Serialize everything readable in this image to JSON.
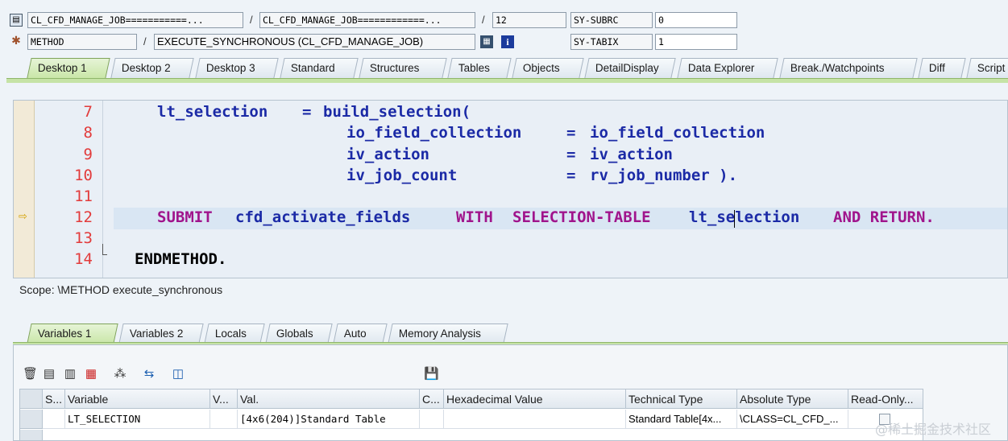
{
  "header": {
    "row1": {
      "field1": "CL_CFD_MANAGE_JOB===========...",
      "field2": "CL_CFD_MANAGE_JOB============...",
      "field3": "12",
      "sysvar_name": "SY-SUBRC",
      "sysvar_value": "0"
    },
    "row2": {
      "field1": "METHOD",
      "field2": "EXECUTE_SYNCHRONOUS (CL_CFD_MANAGE_JOB)",
      "sysvar_name": "SY-TABIX",
      "sysvar_value": "1"
    },
    "slash": "/"
  },
  "tabs": [
    "Desktop 1",
    "Desktop 2",
    "Desktop 3",
    "Standard",
    "Structures",
    "Tables",
    "Objects",
    "DetailDisplay",
    "Data Explorer",
    "Break./Watchpoints",
    "Diff",
    "Script"
  ],
  "editor": {
    "line_numbers": [
      "7",
      "8",
      "9",
      "10",
      "11",
      "12",
      "13",
      "14"
    ],
    "current_line_marker": "⇨",
    "lines": {
      "l7_a": "lt_selection",
      "l7_b": "=",
      "l7_c": "build_selection(",
      "l8_a": "io_field_collection",
      "l8_b": "=",
      "l8_c": "io_field_collection",
      "l9_a": "iv_action",
      "l9_b": "=",
      "l9_c": "iv_action",
      "l10_a": "iv_job_count",
      "l10_b": "=",
      "l10_c": "rv_job_number ).",
      "l12_a": "SUBMIT",
      "l12_b": "cfd_activate_fields",
      "l12_c": "WITH",
      "l12_d": "SELECTION-TABLE",
      "l12_e": "lt_selection",
      "l12_f": "AND RETURN.",
      "l14_a": "ENDMETHOD."
    }
  },
  "scope_text": "Scope: \\METHOD execute_synchronous",
  "var_tabs": [
    "Variables 1",
    "Variables 2",
    "Locals",
    "Globals",
    "Auto",
    "Memory Analysis"
  ],
  "grid": {
    "headers": [
      "S...",
      "Variable",
      "V...",
      "Val.",
      "C...",
      "Hexadecimal Value",
      "Technical Type",
      "Absolute Type",
      "Read-Only..."
    ],
    "row": {
      "variable": "LT_SELECTION",
      "value": "[4x6(204)]Standard Table",
      "technical_type": "Standard Table[4x...",
      "absolute_type": "\\CLASS=CL_CFD_..."
    }
  },
  "watermark": "@稀土掘金技术社区",
  "colors": {
    "keyword": "#a0148c",
    "identifier": "#1b2aa6",
    "line_number": "#e23b3b",
    "active_tab": "#c9e6a8"
  }
}
